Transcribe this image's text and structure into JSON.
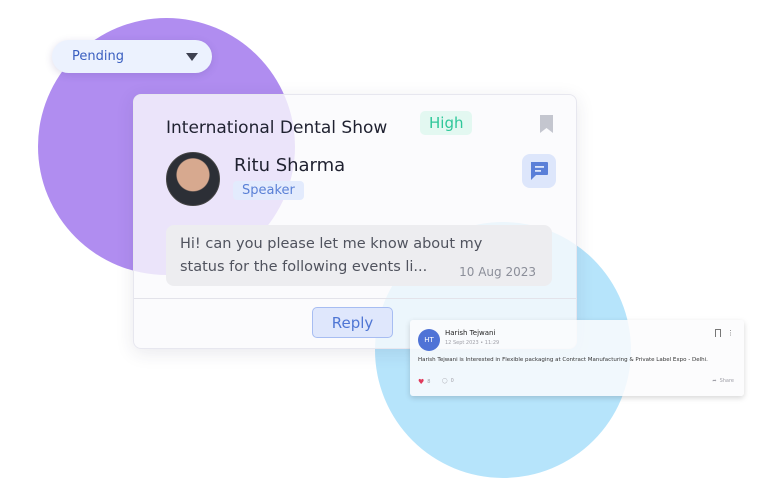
{
  "status_dropdown": {
    "selected": "Pending"
  },
  "event_card": {
    "title": "International Dental Show",
    "priority": "High",
    "person": {
      "name": "Ritu Sharma",
      "role": "Speaker"
    },
    "message": {
      "text": "Hi! can you please let me know about my status for the following events li...",
      "date": "10 Aug 2023"
    },
    "reply_label": "Reply",
    "colors": {
      "priority_text": "#2fc79a",
      "accent": "#4f76d4"
    }
  },
  "post_card": {
    "avatar_initials": "HT",
    "author": "Harish Tejwani",
    "meta": "12 Sept 2023 • 11:29",
    "text": "Harish Tejwani is Interested in Flexible packaging at Contract Manufacturing & Private Label Expo - Delhi.",
    "likes": "8",
    "comments": "0",
    "share_label": "Share"
  }
}
